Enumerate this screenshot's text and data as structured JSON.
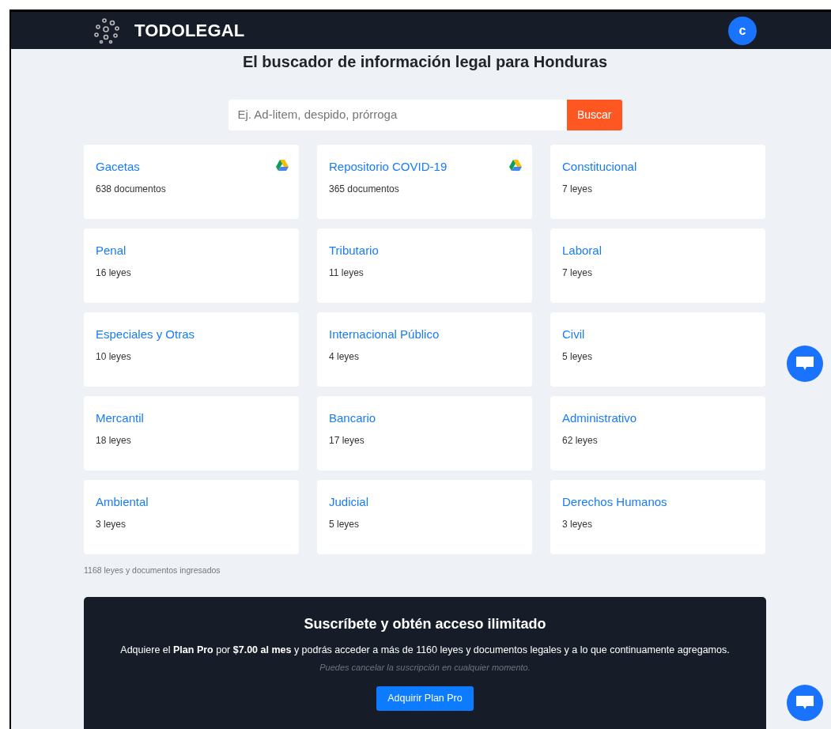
{
  "navbar": {
    "brand": "TODOLEGAL",
    "avatar": "c"
  },
  "heading": "El buscador de información legal para Honduras",
  "search": {
    "placeholder": "Ej. Ad-litem, despido, prórroga",
    "button": "Buscar"
  },
  "categories": [
    {
      "title": "Gacetas",
      "count": "638 documentos",
      "drive": true
    },
    {
      "title": "Repositorio COVID-19",
      "count": "365 documentos",
      "drive": true
    },
    {
      "title": "Constitucional",
      "count": "7 leyes",
      "drive": false
    },
    {
      "title": "Penal",
      "count": "16 leyes",
      "drive": false
    },
    {
      "title": "Tributario",
      "count": "11 leyes",
      "drive": false
    },
    {
      "title": "Laboral",
      "count": "7 leyes",
      "drive": false
    },
    {
      "title": "Especiales y Otras",
      "count": "10 leyes",
      "drive": false
    },
    {
      "title": "Internacional Público",
      "count": "4 leyes",
      "drive": false
    },
    {
      "title": "Civil",
      "count": "5 leyes",
      "drive": false
    },
    {
      "title": "Mercantil",
      "count": "18 leyes",
      "drive": false
    },
    {
      "title": "Bancario",
      "count": "17 leyes",
      "drive": false
    },
    {
      "title": "Administrativo",
      "count": "62 leyes",
      "drive": false
    },
    {
      "title": "Ambiental",
      "count": "3 leyes",
      "drive": false
    },
    {
      "title": "Judicial",
      "count": "5 leyes",
      "drive": false
    },
    {
      "title": "Derechos Humanos",
      "count": "3 leyes",
      "drive": false
    }
  ],
  "total_note": "1168 leyes y documentos ingresados",
  "subscribe": {
    "title": "Suscríbete y obtén acceso ilimitado",
    "text": "Adquiere el **Plan Pro** por **$7.00 al mes** y podrás acceder a más de 1160 leyes y documentos legales y a lo que continuamente agregamos.",
    "note": "Puedes cancelar la suscripción en cualquier momento.",
    "button": "Adquirir Plan Pro"
  }
}
